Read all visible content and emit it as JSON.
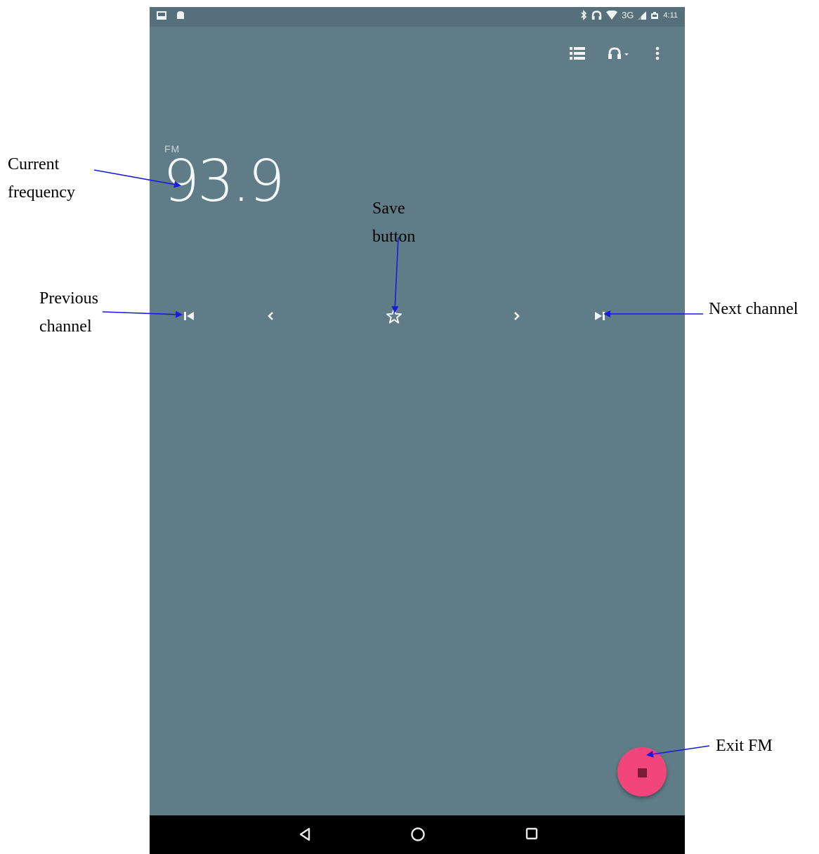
{
  "status_bar": {
    "network": "3G",
    "time": "4:11",
    "icons": [
      "image-icon",
      "android-icon",
      "bluetooth-icon",
      "headphones-icon",
      "wifi-icon",
      "signal-icon",
      "battery-icon"
    ]
  },
  "toolbar": {
    "icons": [
      "station-list-icon",
      "audio-output-icon",
      "more-options-icon"
    ]
  },
  "radio": {
    "band": "FM",
    "frequency": "93.9"
  },
  "controls": [
    "previous-channel-icon",
    "seek-down-icon",
    "favorite-star-icon",
    "seek-up-icon",
    "next-channel-icon"
  ],
  "nav_bar": [
    "back-icon",
    "home-icon",
    "recents-icon"
  ],
  "fab": {
    "icon": "stop-icon",
    "color": "#f2457c"
  },
  "annotations": {
    "current_frequency": [
      "Current",
      "frequency"
    ],
    "save_button": [
      "Save",
      "button"
    ],
    "previous_channel": [
      "Previous",
      "channel"
    ],
    "next_channel": "Next channel",
    "exit_fm": "Exit FM"
  },
  "colors": {
    "screen_background": "#607d87",
    "arrow": "#1a1adc",
    "fab": "#f2457c"
  }
}
